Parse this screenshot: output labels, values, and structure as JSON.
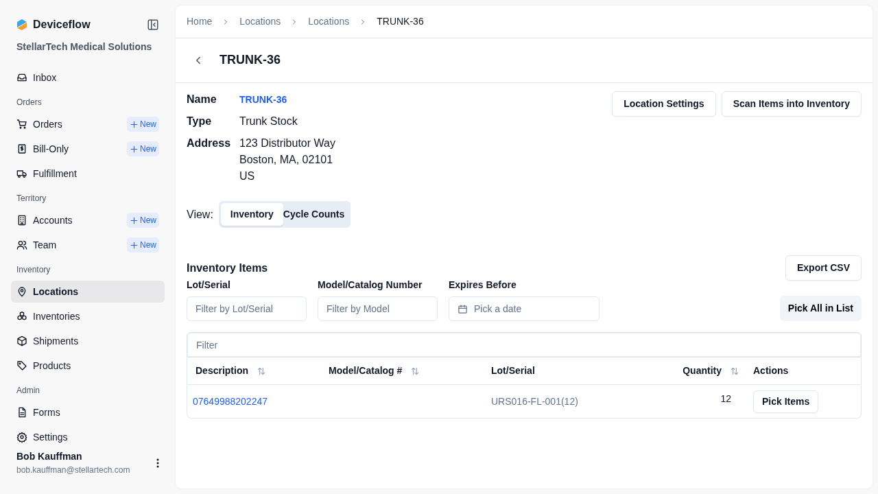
{
  "sidebar": {
    "brand": "Deviceflow",
    "org": "StellarTech Medical Solutions",
    "sections": [
      {
        "items": [
          {
            "label": "Inbox",
            "selected": false
          }
        ]
      },
      {
        "heading": "Orders",
        "items": [
          {
            "label": "Orders",
            "selected": false,
            "badge": "New"
          },
          {
            "label": "Bill-Only",
            "selected": false,
            "badge": "New"
          },
          {
            "label": "Fulfillment",
            "selected": false
          }
        ]
      },
      {
        "heading": "Territory",
        "items": [
          {
            "label": "Accounts",
            "selected": false,
            "badge": "New"
          },
          {
            "label": "Team",
            "selected": false,
            "badge": "New"
          }
        ]
      },
      {
        "heading": "Inventory",
        "items": [
          {
            "label": "Locations",
            "selected": true
          },
          {
            "label": "Inventories",
            "selected": false
          },
          {
            "label": "Shipments",
            "selected": false
          },
          {
            "label": "Products",
            "selected": false
          }
        ]
      },
      {
        "heading": "Admin",
        "items": [
          {
            "label": "Forms",
            "selected": false
          },
          {
            "label": "Settings",
            "selected": false
          }
        ]
      }
    ],
    "user": {
      "name": "Bob Kauffman",
      "email": "bob.kauffman@stellartech.com"
    }
  },
  "breadcrumb": [
    "Home",
    "Locations",
    "Locations",
    "TRUNK-36"
  ],
  "title": "TRUNK-36",
  "details": [
    {
      "label": "Name",
      "lines": [
        "TRUNK-36"
      ],
      "kind": "link"
    },
    {
      "label": "Type",
      "lines": [
        "Trunk Stock"
      ],
      "kind": "text"
    },
    {
      "label": "Address",
      "lines": [
        "123 Distributor Way",
        "Boston, MA, 02101",
        "US"
      ],
      "kind": "text"
    }
  ],
  "actions": [
    "Location Settings",
    "Scan Items into Inventory"
  ],
  "view": {
    "label": "View:",
    "options": [
      {
        "label": "Inventory",
        "selected": true
      },
      {
        "label": "Cycle Counts",
        "selected": false
      }
    ]
  },
  "inventory": {
    "heading": "Inventory Items",
    "export": "Export CSV",
    "filters": [
      {
        "label": "Lot/Serial",
        "placeholder": "Filter by Lot/Serial",
        "kind": "text"
      },
      {
        "label": "Model/Catalog Number",
        "placeholder": "Filter by Model",
        "kind": "text"
      },
      {
        "label": "Expires Before",
        "placeholder": "Pick a date",
        "kind": "date"
      }
    ],
    "pick_all": "Pick All in List",
    "table_filter": {
      "placeholder": "Filter"
    },
    "columns": [
      {
        "label": "Description",
        "sortable": true
      },
      {
        "label": "Model/Catalog #",
        "sortable": true
      },
      {
        "label": "Lot/Serial",
        "sortable": false
      },
      {
        "label": "Quantity",
        "sortable": true
      },
      {
        "label": "Actions",
        "sortable": false
      }
    ],
    "rows": [
      {
        "description": "07649988202247",
        "lot": "URS016-FL-001(12)",
        "quantity": "12",
        "action": "Pick Items"
      }
    ]
  }
}
